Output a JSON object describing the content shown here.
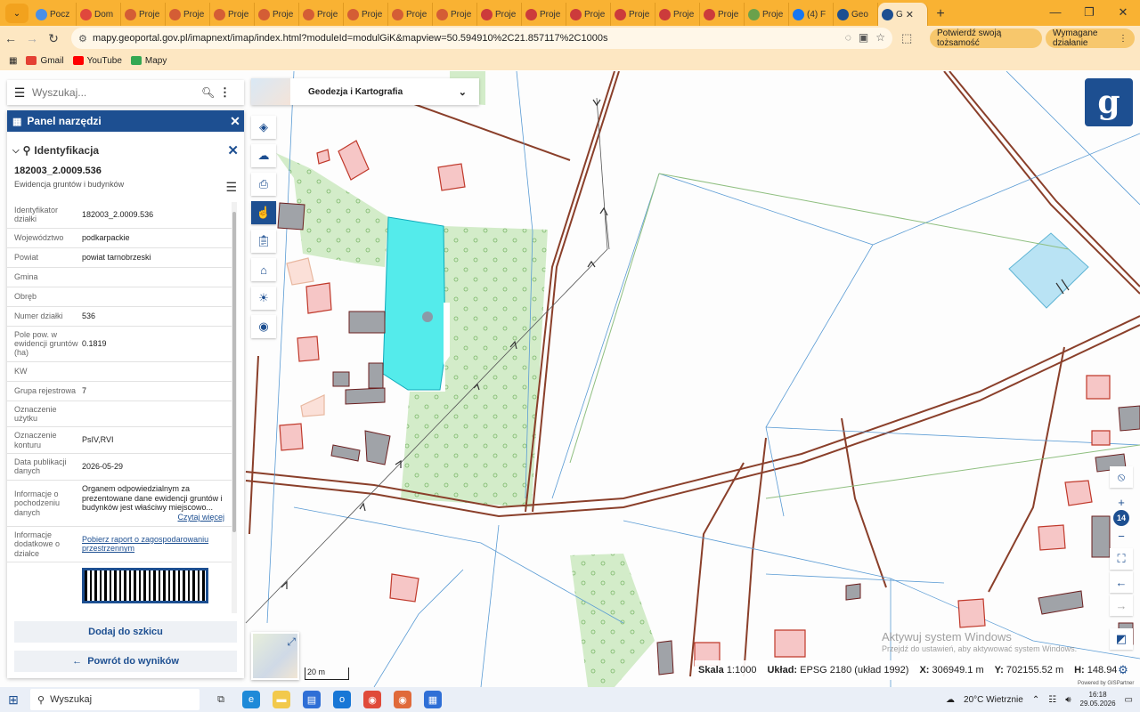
{
  "browser": {
    "tabs": [
      {
        "label": "Pocz",
        "color": "#4a8fe7"
      },
      {
        "label": "Dom",
        "color": "#e0483c"
      },
      {
        "label": "Proje",
        "color": "#d45d35"
      },
      {
        "label": "Proje",
        "color": "#d45d35"
      },
      {
        "label": "Proje",
        "color": "#d45d35"
      },
      {
        "label": "Proje",
        "color": "#d45d35"
      },
      {
        "label": "Proje",
        "color": "#d45d35"
      },
      {
        "label": "Proje",
        "color": "#d45d35"
      },
      {
        "label": "Proje",
        "color": "#d45d35"
      },
      {
        "label": "Proje",
        "color": "#d45d35"
      },
      {
        "label": "Proje",
        "color": "#cc3b3b"
      },
      {
        "label": "Proje",
        "color": "#cc3b3b"
      },
      {
        "label": "Proje",
        "color": "#cc3b3b"
      },
      {
        "label": "Proje",
        "color": "#cc3b3b"
      },
      {
        "label": "Proje",
        "color": "#cc3b3b"
      },
      {
        "label": "Proje",
        "color": "#cc3b3b"
      },
      {
        "label": "Proje",
        "color": "#6ba14b"
      },
      {
        "label": "(4) F",
        "color": "#1877f2"
      },
      {
        "label": "Geo",
        "color": "#1d4f91"
      }
    ],
    "active_tab": "G",
    "url": "mapy.geoportal.gov.pl/imapnext/imap/index.html?moduleId=modulGiK&mapview=50.594910%2C21.857117%2C1000s",
    "identity_button": "Potwierdź swoją tożsamość",
    "action_button": "Wymagane działanie",
    "bookmarks": [
      {
        "label": "Gmail",
        "color": "#e44134"
      },
      {
        "label": "YouTube",
        "color": "#ff0000"
      },
      {
        "label": "Mapy",
        "color": "#34a853"
      }
    ]
  },
  "search": {
    "placeholder": "Wyszukaj..."
  },
  "panel": {
    "title": "Panel narzędzi",
    "section": "Identyfikacja",
    "parcel_id": "182003_2.0009.536",
    "subtitle": "Ewidencja gruntów i budynków",
    "rows": [
      {
        "k": "Identyfikator działki",
        "v": "182003_2.0009.536"
      },
      {
        "k": "Województwo",
        "v": "podkarpackie"
      },
      {
        "k": "Powiat",
        "v": "powiat tarnobrzeski"
      },
      {
        "k": "Gmina",
        "v": ""
      },
      {
        "k": "Obręb",
        "v": ""
      },
      {
        "k": "Numer działki",
        "v": "536"
      },
      {
        "k": "Pole pow. w ewidencji gruntów (ha)",
        "v": "0.1819"
      },
      {
        "k": "KW",
        "v": ""
      },
      {
        "k": "Grupa rejestrowa",
        "v": "7"
      },
      {
        "k": "Oznaczenie użytku",
        "v": ""
      },
      {
        "k": "Oznaczenie konturu",
        "v": "PsIV,RVI"
      },
      {
        "k": "Data publikacji danych",
        "v": "2026-05-29"
      }
    ],
    "info_source_label": "Informacje o pochodzeniu danych",
    "info_source_text": "Organem odpowiedzialnym za prezentowane dane ewidencji gruntów i budynków jest właściwy miejscowo...",
    "read_more": "Czytaj więcej",
    "info_extra_label": "Informacje dodatkowe o działce",
    "info_extra_link": "Pobierz raport o zagospodarowaniu przestrzennym",
    "add_sketch": "Dodaj do szkicu",
    "back": "Powrót do wyników"
  },
  "theme": {
    "label": "Geodezja i Kartografia"
  },
  "map": {
    "zoom_level": "14",
    "scale_bar": "20 m",
    "status": {
      "scale_label": "Skala",
      "scale_value": "1:1000",
      "crs_label": "Układ:",
      "crs_value": "EPSG 2180 (układ 1992)",
      "x_label": "X:",
      "x_value": "306949.1 m",
      "y_label": "Y:",
      "y_value": "702155.52 m",
      "h_label": "H:",
      "h_value": "148.94"
    },
    "watermark_line1": "Aktywuj system Windows",
    "watermark_line2": "Przejdź do ustawień, aby aktywować system Windows.",
    "powered": "Powered by GISPartner"
  },
  "taskbar": {
    "search_placeholder": "Wyszukaj",
    "weather": "20°C  Wietrznie",
    "time": "16:18",
    "date": "29.05.2026"
  }
}
